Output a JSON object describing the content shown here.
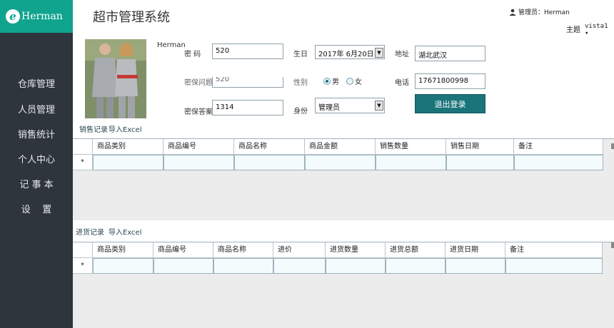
{
  "logo": {
    "text": "Herman"
  },
  "app_title": "超市管理系统",
  "user": {
    "label": "管理员：Herman"
  },
  "theme": {
    "label": "主题",
    "value": "vista1"
  },
  "sidebar": {
    "items": [
      {
        "label": "仓库管理"
      },
      {
        "label": "人员管理"
      },
      {
        "label": "销售统计"
      },
      {
        "label": "个人中心"
      },
      {
        "label": "记 事 本"
      },
      {
        "label": "设    置"
      }
    ]
  },
  "profile": {
    "name": "Herman",
    "sales_record_link": "销售记录",
    "export_excel_link": "导入Excel"
  },
  "form": {
    "password_label": "密 码",
    "password_value": "520",
    "birthday_label": "生日",
    "birthday_value": "2017年 6月20日",
    "address_label": "地址",
    "address_value": "湖北武汉",
    "security_question_label": "密保问题",
    "security_question_value": "520",
    "gender_label": "性别",
    "gender_male": "男",
    "gender_female": "女",
    "phone_label": "电话",
    "phone_value": "17671800998",
    "security_answer_label": "密保答案",
    "security_answer_value": "1314",
    "role_label": "身份",
    "role_value": "管理员",
    "logout_label": "退出登录"
  },
  "sales_grid": {
    "columns": [
      "商品类别",
      "商品编号",
      "商品名称",
      "商品金额",
      "销售数量",
      "销售日期",
      "备注"
    ],
    "new_row_marker": "*"
  },
  "purchase_section": {
    "record_link": "进货记录",
    "export_excel_link": "导入Excel"
  },
  "purchase_grid": {
    "columns": [
      "商品类别",
      "商品编号",
      "商品名称",
      "进价",
      "进货数量",
      "进货总额",
      "进货日期",
      "备注"
    ],
    "new_row_marker": "*"
  }
}
